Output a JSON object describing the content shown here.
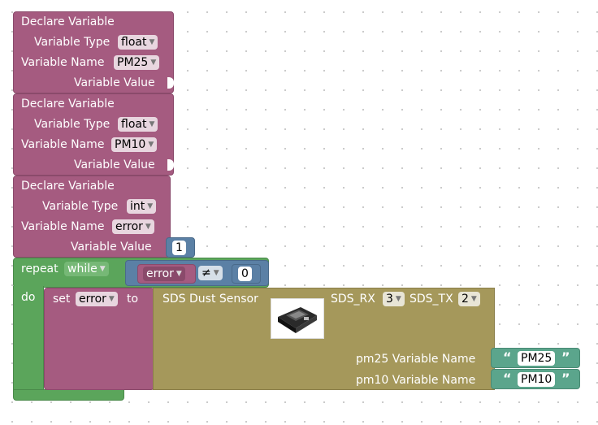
{
  "declare_blocks": [
    {
      "title": "Declare Variable",
      "type_label": "Variable Type",
      "type_value": "float",
      "name_label": "Variable Name",
      "name_value": "PM25",
      "value_label": "Variable Value"
    },
    {
      "title": "Declare Variable",
      "type_label": "Variable Type",
      "type_value": "float",
      "name_label": "Variable Name",
      "name_value": "PM10",
      "value_label": "Variable Value"
    },
    {
      "title": "Declare Variable",
      "type_label": "Variable Type",
      "type_value": "int",
      "name_label": "Variable Name",
      "name_value": "error",
      "value_label": "Variable Value",
      "value_number": "1"
    }
  ],
  "repeat_block": {
    "repeat_label": "repeat",
    "mode": "while",
    "do_label": "do",
    "condition": {
      "variable": "error",
      "operator": "≠",
      "number": "0"
    }
  },
  "set_block": {
    "set_label": "set",
    "variable": "error",
    "to_label": "to"
  },
  "sensor_block": {
    "title": "SDS Dust Sensor",
    "rx_label": "SDS_RX",
    "rx_value": "3",
    "tx_label": "SDS_TX",
    "tx_value": "2",
    "pm25_label": "pm25 Variable Name",
    "pm25_value": "PM25",
    "pm10_label": "pm10 Variable Name",
    "pm10_value": "PM10"
  },
  "icons": {
    "dropdown": "▼",
    "quote_open": "“",
    "quote_close": "”"
  },
  "colors": {
    "variable_block": "#a55b80",
    "loop_block": "#5ba55b",
    "logic_block": "#5b80a5",
    "sensor_block": "#a5985b",
    "text_block": "#5ba58c"
  }
}
